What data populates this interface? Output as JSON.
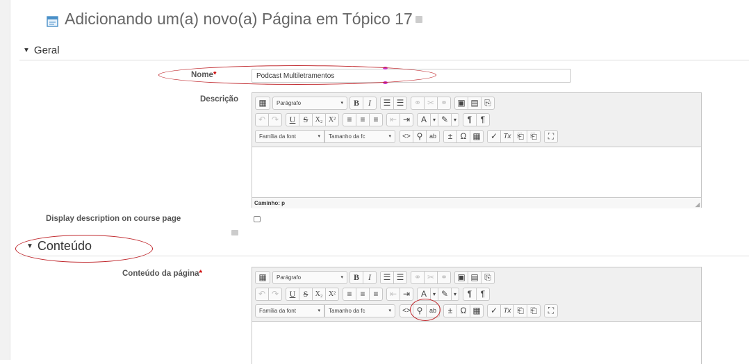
{
  "page": {
    "title": "Adicionando um(a) novo(a) Página em Tópico 17"
  },
  "sections": {
    "geral": "Geral",
    "conteudo": "Conteúdo"
  },
  "fields": {
    "nome_label": "Nome",
    "nome_required": "*",
    "nome_value": "Podcast Multiletramentos",
    "descricao_label": "Descrição",
    "display_description_label": "Display description on course page",
    "conteudo_pagina_label": "Conteúdo da página",
    "conteudo_required": "*"
  },
  "editor": {
    "paragraph": "Parágrafo",
    "font_family": "Família da font",
    "font_size": "Tamanho da fc",
    "path_label": "Caminho: p"
  },
  "icons": {
    "bold": "B",
    "italic": "I",
    "underline": "U",
    "strike": "S",
    "subscript": "X₂",
    "superscript": "X²",
    "html": "<>",
    "omega": "Ω",
    "clear": "Tx",
    "grip": "◢",
    "caret": "▼",
    "arrow": "▾"
  },
  "colors": {
    "annotation": "#c0282d",
    "required": "#cc0000",
    "cursor_marker": "#cc33cc"
  }
}
